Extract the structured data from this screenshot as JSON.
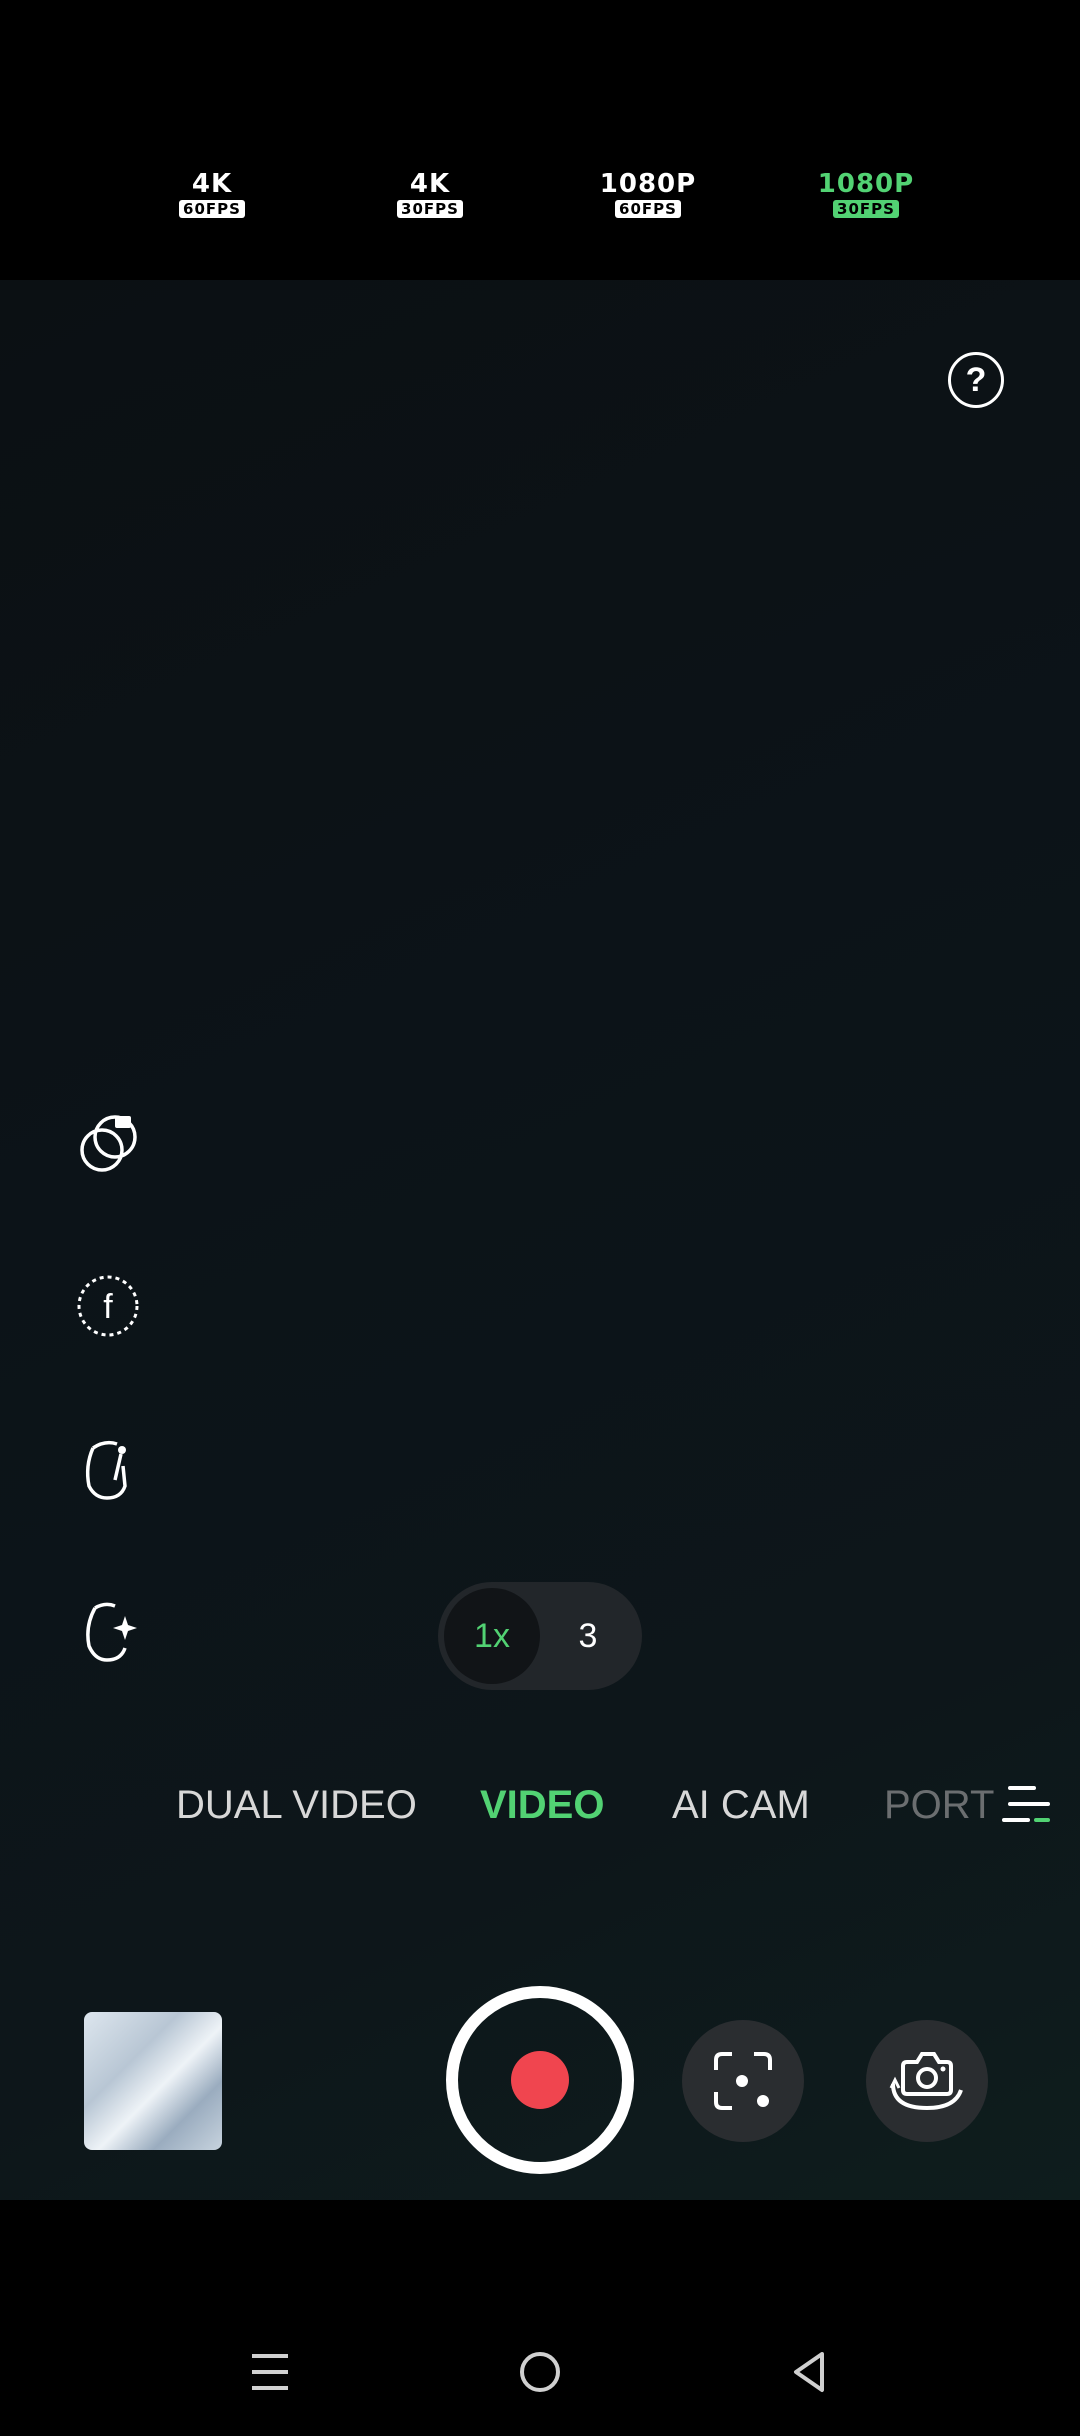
{
  "resolution_bar": {
    "options": [
      {
        "main": "4K",
        "fps": "60FPS",
        "active": false
      },
      {
        "main": "4K",
        "fps": "30FPS",
        "active": false
      },
      {
        "main": "1080P",
        "fps": "60FPS",
        "active": false
      },
      {
        "main": "1080P",
        "fps": "30FPS",
        "active": true
      }
    ]
  },
  "help": {
    "label": "?"
  },
  "side_tools": {
    "icons": [
      "filter-icon",
      "film-filter-icon",
      "retouch-icon",
      "beauty-icon"
    ]
  },
  "zoom": {
    "selected": "1x",
    "other": "3"
  },
  "modes": {
    "items": [
      "DUAL VIDEO",
      "VIDEO",
      "AI CAM",
      "PORTR"
    ],
    "selected": "VIDEO"
  },
  "bottom": {
    "icons": [
      "gallery-thumbnail",
      "record-icon",
      "scan-icon",
      "flip-camera-icon"
    ]
  },
  "navbar": {
    "icons": [
      "menu-icon",
      "home-icon",
      "back-icon"
    ]
  },
  "colors": {
    "accent": "#52d273",
    "record": "#f0454f",
    "background": "#000000"
  }
}
